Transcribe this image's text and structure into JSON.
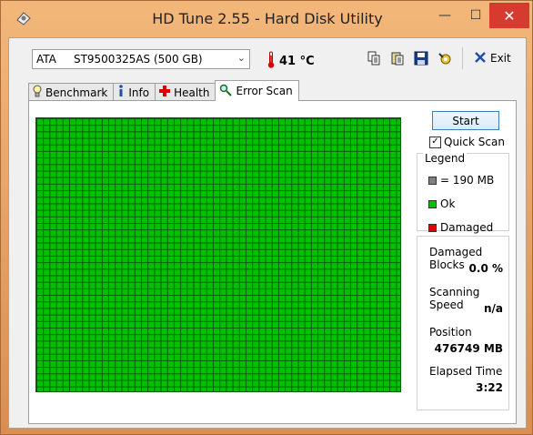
{
  "window": {
    "title": "HD Tune 2.55 - Hard Disk Utility",
    "minimize_glyph": "—",
    "maximize_glyph": "☐",
    "close_glyph": "✕"
  },
  "drive": {
    "selected": "ATA     ST9500325AS (500 GB)"
  },
  "temperature": {
    "value": "41 °C",
    "icon": "thermometer-icon"
  },
  "toolbar": {
    "icons": [
      "copy-icon",
      "paste-icon",
      "save-icon",
      "options-icon"
    ],
    "exit_label": "Exit"
  },
  "tabs": [
    {
      "label": "Benchmark",
      "icon": "lightbulb-icon"
    },
    {
      "label": "Info",
      "icon": "info-icon"
    },
    {
      "label": "Health",
      "icon": "health-cross-icon"
    },
    {
      "label": "Error Scan",
      "icon": "magnifier-icon"
    }
  ],
  "active_tab": "Error Scan",
  "controls": {
    "start_label": "Start",
    "quick_scan_label": "Quick Scan",
    "quick_scan_checked": true
  },
  "legend": {
    "title": "Legend",
    "items": [
      {
        "label": "= 190 MB",
        "color": "#808080"
      },
      {
        "label": "Ok",
        "color": "#00c000"
      },
      {
        "label": "Damaged",
        "color": "#e00000"
      }
    ]
  },
  "stats": {
    "damaged_blocks_label": "Damaged Blocks",
    "damaged_blocks_value": "0.0 %",
    "scanning_speed_label": "Scanning Speed",
    "scanning_speed_value": "n/a",
    "position_label": "Position",
    "position_value": "476749 MB",
    "elapsed_time_label": "Elapsed Time",
    "elapsed_time_value": "3:22"
  },
  "colors": {
    "block_ok": "#00c000",
    "block_grid": "#006000",
    "close_button": "#d73a2f"
  }
}
